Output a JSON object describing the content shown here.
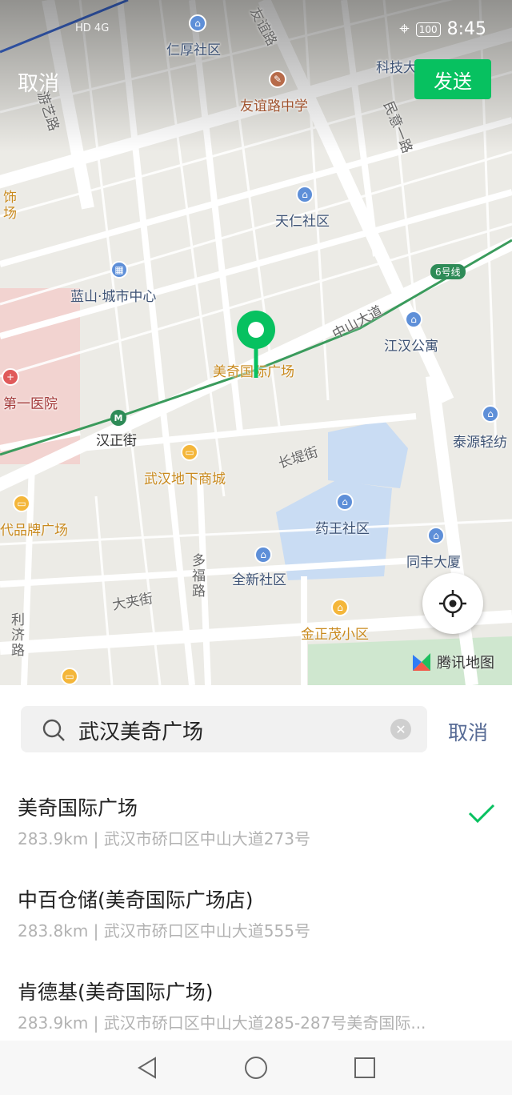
{
  "status_bar": {
    "network": "HD 4G",
    "battery": "100",
    "time": "8:45"
  },
  "top_bar": {
    "cancel_label": "取消",
    "send_label": "发送"
  },
  "map": {
    "pois": [
      {
        "id": "renhou",
        "label": "仁厚社区"
      },
      {
        "id": "keji",
        "label": "科技大厦"
      },
      {
        "id": "youyi-school",
        "label": "友谊路中学"
      },
      {
        "id": "tianren",
        "label": "天仁社区"
      },
      {
        "id": "lanshan",
        "label": "蓝山·城市中心"
      },
      {
        "id": "meiqi",
        "label": "美奇国际广场"
      },
      {
        "id": "jianghan-apt",
        "label": "江汉公寓"
      },
      {
        "id": "hospital",
        "label": "第一医院"
      },
      {
        "id": "hanzhengjie",
        "label": "汉正街"
      },
      {
        "id": "taiyuan",
        "label": "泰源轻纺"
      },
      {
        "id": "underground-mall",
        "label": "武汉地下商城"
      },
      {
        "id": "yaowang",
        "label": "药王社区"
      },
      {
        "id": "brand-plaza",
        "label": "代品牌广场"
      },
      {
        "id": "tongfeng",
        "label": "同丰大厦"
      },
      {
        "id": "quanxin",
        "label": "全新社区"
      },
      {
        "id": "jinzhengmao",
        "label": "金正茂小区"
      },
      {
        "id": "shishi",
        "label": "饰"
      },
      {
        "id": "chang",
        "label": "场"
      }
    ],
    "roads": [
      {
        "id": "youyi-road",
        "label": "友谊路"
      },
      {
        "id": "youyi-road-2",
        "label": "游艺路"
      },
      {
        "id": "minyi",
        "label": "民意一路"
      },
      {
        "id": "zhongshan",
        "label": "中山大道"
      },
      {
        "id": "changdi",
        "label": "长堤街"
      },
      {
        "id": "duofu",
        "label": "多福路"
      },
      {
        "id": "dajia",
        "label": "大夹街"
      },
      {
        "id": "liji",
        "label": "利济路"
      }
    ],
    "metro_line": "6号线",
    "logo_text": "腾讯地图"
  },
  "search": {
    "query": "武汉美奇广场",
    "cancel_label": "取消"
  },
  "results": [
    {
      "name": "美奇国际广场",
      "detail": "283.9km | 武汉市硚口区中山大道273号",
      "selected": true
    },
    {
      "name": "中百仓储(美奇国际广场店)",
      "detail": "283.8km | 武汉市硚口区中山大道555号",
      "selected": false
    },
    {
      "name": "肯德基(美奇国际广场)",
      "detail": "283.9km | 武汉市硚口区中山大道285-287号美奇国际...",
      "selected": false
    }
  ],
  "colors": {
    "accent": "#07c160",
    "link": "#576b95",
    "metro": "#2e8b57"
  }
}
